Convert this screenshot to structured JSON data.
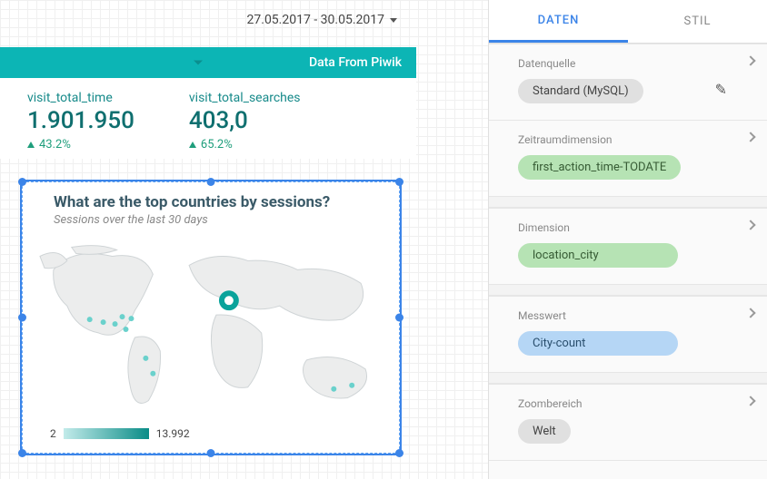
{
  "date_range": "27.05.2017 - 30.05.2017",
  "banner_title": "Data From Piwik",
  "metrics": [
    {
      "label": "visit_total_time",
      "value": "1.901.950",
      "delta": "43.2%"
    },
    {
      "label": "visit_total_searches",
      "value": "403,0",
      "delta": "65.2%"
    }
  ],
  "map": {
    "title": "What are the top countries by sessions?",
    "subtitle": "Sessions over the last 30 days",
    "legend_min": "2",
    "legend_max": "13.992"
  },
  "side": {
    "tab_data": "DATEN",
    "tab_style": "STIL",
    "sections": {
      "datasource_label": "Datenquelle",
      "datasource_chip": "Standard (MySQL)",
      "timedim_label": "Zeitraumdimension",
      "timedim_chip": "first_action_time-TODATE",
      "dimension_label": "Dimension",
      "dimension_chip": "location_city",
      "metric_label": "Messwert",
      "metric_chip": "City-count",
      "zoom_label": "Zoombereich",
      "zoom_chip": "Welt"
    }
  }
}
